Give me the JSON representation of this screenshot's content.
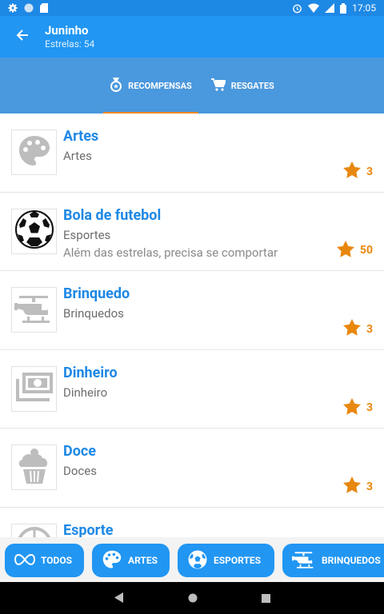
{
  "status_bar": {
    "time": "17:05"
  },
  "app_bar": {
    "title": "Juninho",
    "subtitle": "Estrelas: 54"
  },
  "tabs": [
    {
      "label": "RECOMPENSAS",
      "icon": "medal-icon",
      "active": true
    },
    {
      "label": "RESGATES",
      "icon": "cart-icon",
      "active": false
    }
  ],
  "rewards": [
    {
      "title": "Artes",
      "category": "Artes",
      "description": "",
      "stars": "3",
      "icon": "palette-icon"
    },
    {
      "title": "Bola de futebol",
      "category": "Esportes",
      "description": "Além das estrelas, precisa se comportar",
      "stars": "50",
      "icon": "soccer-ball-icon"
    },
    {
      "title": "Brinquedo",
      "category": "Brinquedos",
      "description": "",
      "stars": "3",
      "icon": "helicopter-icon"
    },
    {
      "title": "Dinheiro",
      "category": "Dinheiro",
      "description": "",
      "stars": "3",
      "icon": "money-icon"
    },
    {
      "title": "Doce",
      "category": "Doces",
      "description": "",
      "stars": "3",
      "icon": "cupcake-icon"
    },
    {
      "title": "Esporte",
      "category": "",
      "description": "",
      "stars": "",
      "icon": "ball-icon"
    }
  ],
  "filters": [
    {
      "label": "TODOS",
      "icon": "infinity-icon"
    },
    {
      "label": "ARTES",
      "icon": "palette-icon"
    },
    {
      "label": "ESPORTES",
      "icon": "soccer-ball-icon"
    },
    {
      "label": "BRINQUEDOS",
      "icon": "helicopter-icon"
    }
  ],
  "colors": {
    "primary": "#2196f3",
    "status": "#1e88e5",
    "tab_bg": "#4a98dd",
    "accent": "#f08a24",
    "star": "#e8870e",
    "title_text": "#1e88e5"
  }
}
